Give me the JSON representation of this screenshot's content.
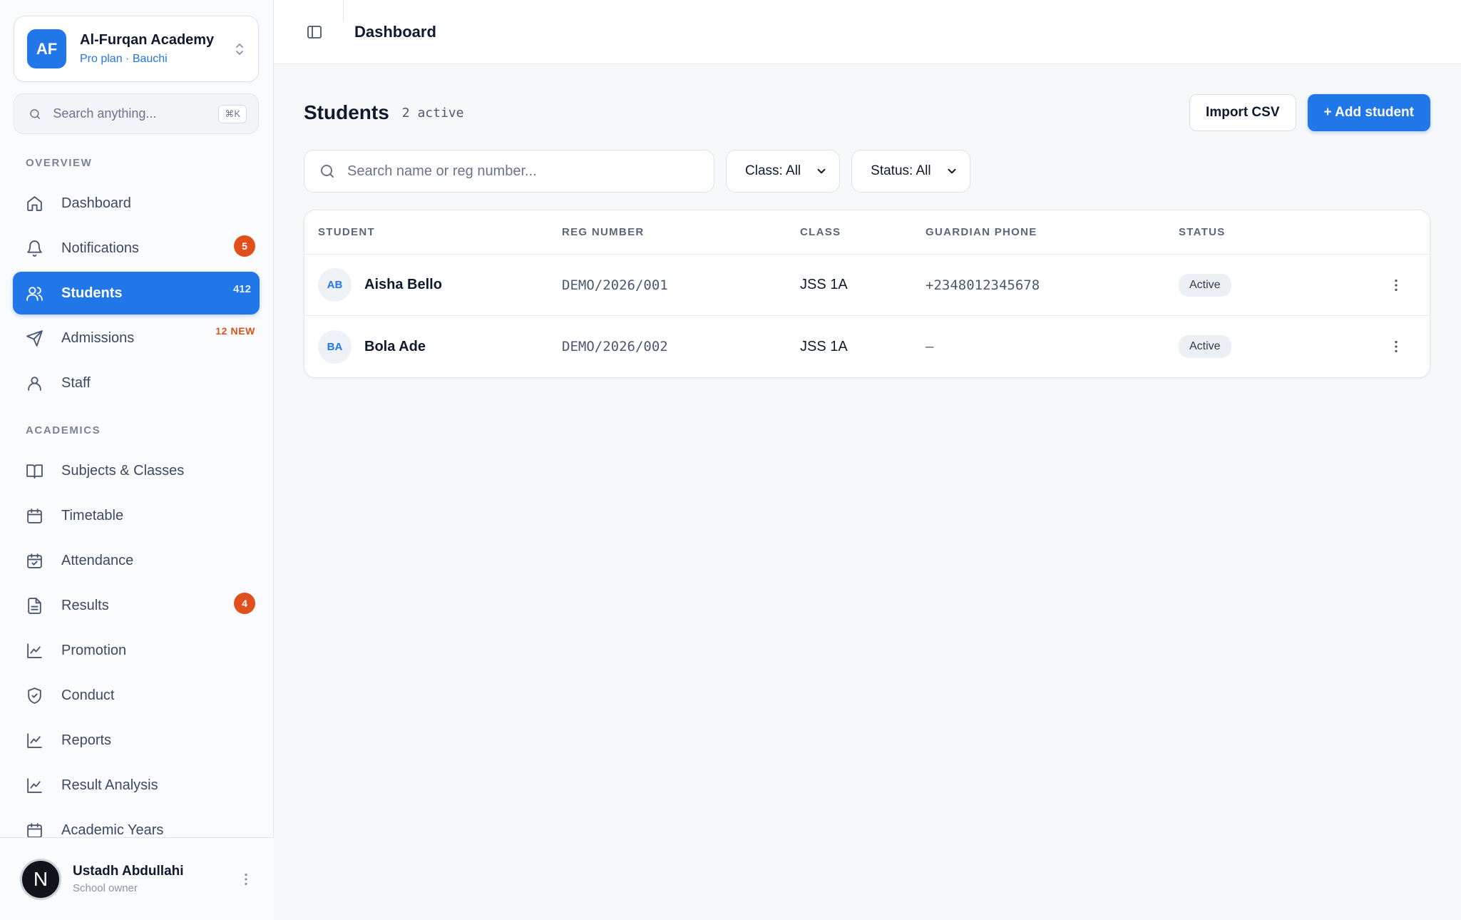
{
  "school": {
    "initials": "AF",
    "name": "Al-Furqan Academy",
    "plan": "Pro plan · Bauchi"
  },
  "sidebar": {
    "search_placeholder": "Search anything...",
    "search_shortcut": "⌘K",
    "sections": {
      "overview": "OVERVIEW",
      "academics": "ACADEMICS"
    },
    "items": [
      {
        "label": "Dashboard",
        "icon": "home-icon"
      },
      {
        "label": "Notifications",
        "icon": "bell-icon",
        "badge": "5"
      },
      {
        "label": "Students",
        "icon": "users-icon",
        "count": "412",
        "active": true
      },
      {
        "label": "Admissions",
        "icon": "send-icon",
        "tag": "12 NEW"
      },
      {
        "label": "Staff",
        "icon": "user-icon"
      },
      {
        "label": "Subjects & Classes",
        "icon": "book-icon"
      },
      {
        "label": "Timetable",
        "icon": "calendar-icon"
      },
      {
        "label": "Attendance",
        "icon": "calendar-check-icon"
      },
      {
        "label": "Results",
        "icon": "file-text-icon",
        "badge": "4"
      },
      {
        "label": "Promotion",
        "icon": "chart-line-icon"
      },
      {
        "label": "Conduct",
        "icon": "shield-check-icon"
      },
      {
        "label": "Reports",
        "icon": "chart-line-icon"
      },
      {
        "label": "Result Analysis",
        "icon": "chart-line-icon"
      },
      {
        "label": "Academic Years",
        "icon": "calendar-icon"
      }
    ]
  },
  "user": {
    "initial": "N",
    "name": "Ustadh Abdullahi",
    "role": "School owner"
  },
  "topbar": {
    "title": "Dashboard"
  },
  "page": {
    "title": "Students",
    "subtitle": "2 active",
    "import_label": "Import CSV",
    "add_label": "+ Add student"
  },
  "filters": {
    "search_placeholder": "Search name or reg number...",
    "class_value": "Class: All",
    "status_value": "Status: All"
  },
  "table": {
    "headers": {
      "student": "STUDENT",
      "reg": "REG NUMBER",
      "class": "CLASS",
      "phone": "GUARDIAN PHONE",
      "status": "STATUS"
    },
    "rows": [
      {
        "initials": "AB",
        "name": "Aisha Bello",
        "reg": "DEMO/2026/001",
        "class": "JSS 1A",
        "phone": "+2348012345678",
        "status": "Active"
      },
      {
        "initials": "BA",
        "name": "Bola Ade",
        "reg": "DEMO/2026/002",
        "class": "JSS 1A",
        "phone": "–",
        "status": "Active"
      }
    ]
  },
  "colors": {
    "accent": "#2176e8",
    "badge": "#e0501d",
    "text": "#0f1a2e"
  }
}
